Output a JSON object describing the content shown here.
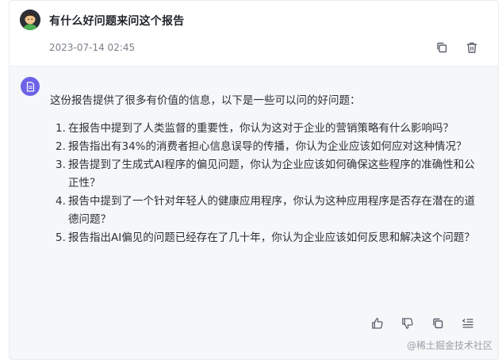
{
  "question": {
    "title": "有什么好问题来问这个报告",
    "date": "2023-07-14 02:45",
    "actions": [
      {
        "icon": "copy-icon"
      },
      {
        "icon": "trash-icon"
      }
    ]
  },
  "answer": {
    "bot_icon": "document-icon",
    "intro": "这份报告提供了很多有价值的信息，以下是一些可以问的好问题：",
    "items": [
      {
        "num": "1.",
        "text": "在报告中提到了人类监督的重要性，你认为这对于企业的营销策略有什么影响吗？"
      },
      {
        "num": "2.",
        "text": "报告指出有34%的消费者担心信息误导的传播，你认为企业应该如何应对这种情况？"
      },
      {
        "num": "3.",
        "text": "报告提到了生成式AI程序的偏见问题，你认为企业应该如何确保这些程序的准确性和公正性？"
      },
      {
        "num": "4.",
        "text": "报告中提到了一个针对年轻人的健康应用程序，你认为这种应用程序是否存在潜在的道德问题？"
      },
      {
        "num": "5.",
        "text": "报告指出AI偏见的问题已经存在了几十年，你认为企业应该如何反思和解决这个问题？"
      }
    ],
    "actions": [
      {
        "icon": "thumbs-up-icon"
      },
      {
        "icon": "thumbs-down-icon"
      },
      {
        "icon": "copy-icon"
      },
      {
        "icon": "collapse-list-icon"
      }
    ]
  },
  "watermark": {
    "text": "@稀土掘金技术社区"
  },
  "colors": {
    "bot_avatar": "#6c63e8",
    "answer_bg": "#f6f7f9",
    "icon": "#5a606b"
  }
}
